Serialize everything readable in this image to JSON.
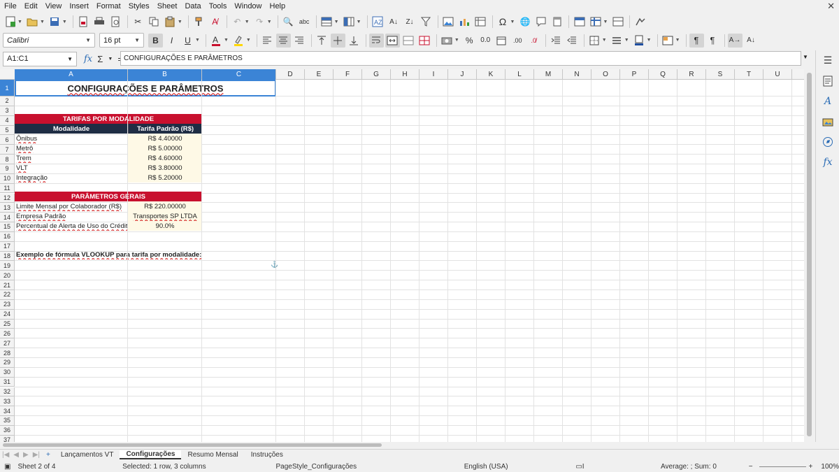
{
  "menu": [
    "File",
    "Edit",
    "View",
    "Insert",
    "Format",
    "Styles",
    "Sheet",
    "Data",
    "Tools",
    "Window",
    "Help"
  ],
  "toolbar": {
    "font_name": "Calibri",
    "font_size": "16 pt",
    "bold": "B",
    "italic": "I",
    "underline": "U",
    "percent": "%",
    "decimal": "0.0"
  },
  "formula_bar": {
    "name_box": "A1:C1",
    "content": "CONFIGURAÇÕES E PARÂMETROS"
  },
  "columns": [
    "A",
    "B",
    "C",
    "D",
    "E",
    "F",
    "G",
    "H",
    "I",
    "J",
    "K",
    "L",
    "M",
    "N",
    "O",
    "P",
    "Q",
    "R",
    "S",
    "T",
    "U"
  ],
  "rows": [
    "1",
    "2",
    "3",
    "4",
    "5",
    "6",
    "7",
    "8",
    "9",
    "10",
    "11",
    "12",
    "13",
    "14",
    "15",
    "16",
    "17",
    "18",
    "19",
    "20",
    "21",
    "22",
    "23",
    "24",
    "25",
    "26",
    "27",
    "28",
    "29",
    "30",
    "31",
    "32",
    "33",
    "34",
    "35",
    "36",
    "37"
  ],
  "sheet": {
    "title": "CONFIGURAÇÕES E PARÂMETROS",
    "tarifas_header": "TARIFAS POR MODALIDADE",
    "col_modalidade": "Modalidade",
    "col_tarifa": "Tarifa Padrão (R$)",
    "tarifas": [
      {
        "name": "Ônibus",
        "value": "R$ 4.40000"
      },
      {
        "name": "Metrô",
        "value": "R$ 5.00000"
      },
      {
        "name": "Trem",
        "value": "R$ 4.60000"
      },
      {
        "name": "VLT",
        "value": "R$ 3.80000"
      },
      {
        "name": "Integração",
        "value": "R$ 5.20000"
      }
    ],
    "params_header": "PARÂMETROS GERAIS",
    "params": [
      {
        "name": "Limite Mensal por Colaborador (R$)",
        "value": "R$ 220.00000"
      },
      {
        "name": "Empresa Padrão",
        "value": "Transportes SP LTDA"
      },
      {
        "name": "Percentual de Alerta de Uso do Crédito",
        "value": "90.0%"
      }
    ],
    "note": "Exemplo de fórmula VLOOKUP para tarifa por modalidade:"
  },
  "tabs": [
    "Lançamentos VT",
    "Configurações",
    "Resumo Mensal",
    "Instruções"
  ],
  "active_tab": "Configurações",
  "status": {
    "sheet": "Sheet 2 of 4",
    "selection": "Selected: 1 row, 3 columns",
    "page_style": "PageStyle_Configurações",
    "language": "English (USA)",
    "summary": "Average: ; Sum: 0",
    "zoom": "100%"
  },
  "colors": {
    "selection": "#3b84d6",
    "header_red": "#c8102e",
    "header_navy": "#1f2d44",
    "value_tint": "#fef9e6"
  }
}
